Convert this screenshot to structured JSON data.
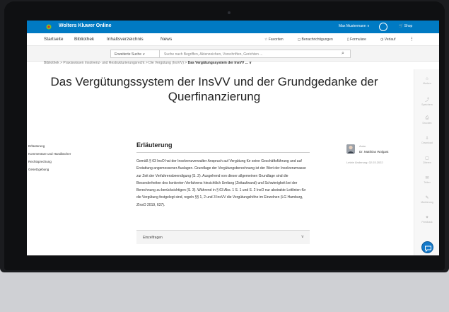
{
  "header": {
    "brand": "Wolters Kluwer Online",
    "user": "Max Mustermann ∨",
    "shop": "Shop"
  },
  "nav": {
    "items": [
      "Startseite",
      "Bibliothek",
      "Inhaltsverzeichnis",
      "News"
    ],
    "right": [
      "Favoriten",
      "Benachrichtigungen",
      "Formulare",
      "Verlauf"
    ]
  },
  "search": {
    "advanced": "Erweiterte Suche ∨",
    "placeholder": "Suche nach Begriffen, Aktenzeichen, Vorschriften, Gerichten ..."
  },
  "breadcrumb": {
    "part1": "Bibliothek  >  Praxiswissen Insolvenz- und Restrukturierungsrecht  >  Die Vergütung (InsVV)  > ",
    "current": "Das Vergütungssystem der InsVV ... ∨"
  },
  "title": "Das Vergütungssystem der InsVV und der Grundgedanke der Querfinanzierung",
  "left_nav": [
    {
      "icon": "⊙",
      "label": "Erläuterung"
    },
    {
      "icon": "□",
      "label": "Kommentare und Handbücher"
    },
    {
      "icon": "♆",
      "label": "Rechtsprechung"
    },
    {
      "icon": "§",
      "label": "Gesetzgebung"
    }
  ],
  "article": {
    "heading": "Erläuterung",
    "text": "Gemäß § 63 InsO hat der Insolvenzverwalter Anspruch auf Vergütung für seine Geschäftsführung und auf Erstattung angemessener Auslagen. Grundlage der Vergütungsberechnung ist der Wert der Insolvenzmasse zur Zeit der Verfahrensbeendigung (S. 2). Ausgehend von dieser allgemeinen Grundlage sind die Besonderheiten des konkreten Verfahrens hinsichtlich Umfang (Zeitaufwand) und Schwierigkeit bei der Berechnung zu berücksichtigen (S. 3). Während in § 63 Abs. 1 S. 1 und S. 2 InsO nur abstrakte Leitlinien für die Vergütung festgelegt sind, regeln §§ 1, 2 und 3 InsVV die Vergütungshöhe im Einzelnen (LG Hamburg, ZInsO 2019, 637).",
    "einzelfragen": "Einzelfragen"
  },
  "author": {
    "role": "Autor",
    "name": "Dr. Matthias Wolgast",
    "last_change": "Letzte Änderung: 02.03.2022"
  },
  "tools": [
    {
      "icon": "☆",
      "label": "Merken"
    },
    {
      "icon": "⤴",
      "label": "Speichern"
    },
    {
      "icon": "⎙",
      "label": "Drucken"
    },
    {
      "icon": "⇩",
      "label": "Download"
    },
    {
      "icon": "▢",
      "label": "Zitieren"
    },
    {
      "icon": "✉",
      "label": "Teilen"
    },
    {
      "icon": "✎",
      "label": "Markierung"
    },
    {
      "icon": "✦",
      "label": "Feedback"
    }
  ],
  "colors": {
    "brand_blue": "#007ac3",
    "logo_green": "#85bc20"
  }
}
